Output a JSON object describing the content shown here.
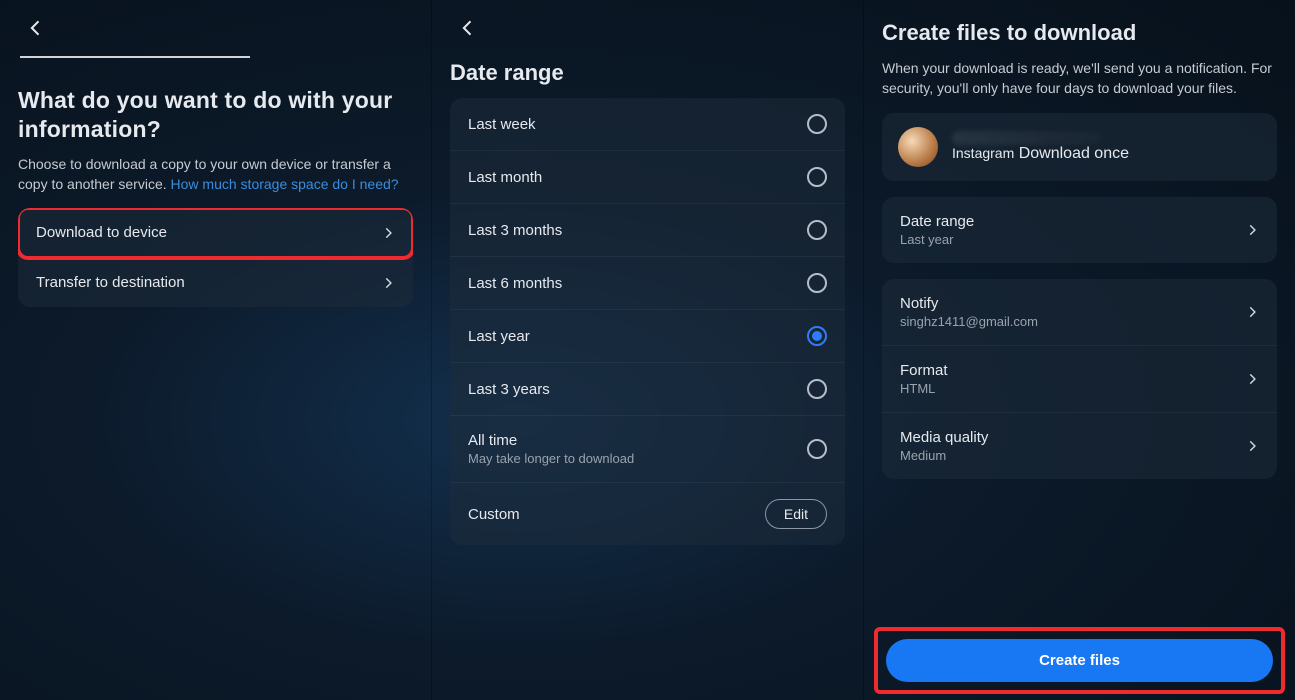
{
  "panel1": {
    "title": "What do you want to do with your information?",
    "desc_pre": "Choose to download a copy to your own device or transfer a copy to another service. ",
    "desc_link": "How much storage space do I need?",
    "options": {
      "download": "Download to device",
      "transfer": "Transfer to destination"
    }
  },
  "panel2": {
    "title": "Date range",
    "items": [
      {
        "label": "Last week",
        "selected": false
      },
      {
        "label": "Last month",
        "selected": false
      },
      {
        "label": "Last 3 months",
        "selected": false
      },
      {
        "label": "Last 6 months",
        "selected": false
      },
      {
        "label": "Last year",
        "selected": true
      },
      {
        "label": "Last 3 years",
        "selected": false
      },
      {
        "label": "All time",
        "sub": "May take longer to download",
        "selected": false
      }
    ],
    "custom_label": "Custom",
    "custom_btn": "Edit"
  },
  "panel3": {
    "title": "Create files to download",
    "desc": "When your download is ready, we'll send you a notification. For security, you'll only have four days to download your files.",
    "account": {
      "service": "Instagram",
      "freq": "Download once"
    },
    "settings": {
      "date_range": {
        "title": "Date range",
        "value": "Last year"
      },
      "notify": {
        "title": "Notify",
        "value": "singhz1411@gmail.com"
      },
      "format": {
        "title": "Format",
        "value": "HTML"
      },
      "media_quality": {
        "title": "Media quality",
        "value": "Medium"
      }
    },
    "cta": "Create files"
  }
}
